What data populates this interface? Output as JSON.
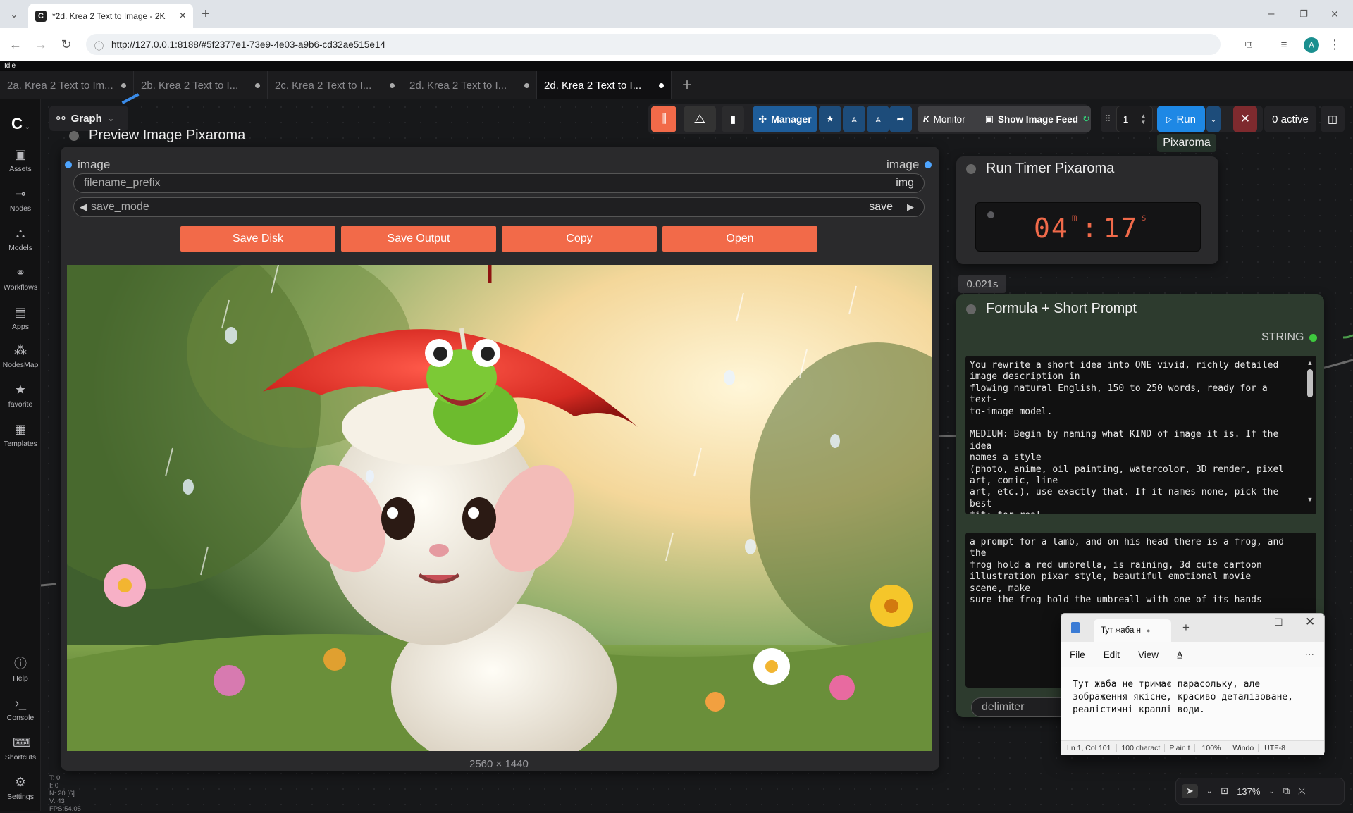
{
  "browser": {
    "tab_title": "*2d. Krea 2 Text to Image - 2K",
    "url": "http://127.0.0.1:8188/#5f2377e1-73e9-4e03-a9b6-cd32ae515e14",
    "avatar_letter": "A"
  },
  "status": {
    "idle": "Idle"
  },
  "workflow_tabs": [
    {
      "label": "2a. Krea 2 Text to Im..."
    },
    {
      "label": "2b. Krea 2 Text to I..."
    },
    {
      "label": "2c. Krea 2 Text to I..."
    },
    {
      "label": "2d. Krea 2 Text to I..."
    },
    {
      "label": "2d. Krea 2 Text to I..."
    }
  ],
  "sidebar": {
    "items": [
      {
        "label": "Assets",
        "icon": "image-icon"
      },
      {
        "label": "Nodes",
        "icon": "nodes-icon"
      },
      {
        "label": "Models",
        "icon": "models-icon"
      },
      {
        "label": "Workflows",
        "icon": "workflows-icon"
      },
      {
        "label": "Apps",
        "icon": "apps-icon"
      },
      {
        "label": "NodesMap",
        "icon": "nodesmap-icon"
      },
      {
        "label": "favorite",
        "icon": "star-icon"
      },
      {
        "label": "Templates",
        "icon": "templates-icon"
      }
    ],
    "bottom": [
      {
        "label": "Help",
        "icon": "help-icon"
      },
      {
        "label": "Console",
        "icon": "console-icon"
      },
      {
        "label": "Shortcuts",
        "icon": "keyboard-icon"
      },
      {
        "label": "Settings",
        "icon": "gear-icon"
      }
    ],
    "stats": [
      "T: 0",
      "I: 0",
      "N: 20 [6]",
      "V: 43",
      "FPS:54.05"
    ]
  },
  "toolbar": {
    "graph_label": "Graph",
    "manager_label": "Manager",
    "monitor_label": "Monitor",
    "monitor_prefix": "K",
    "show_image_feed": "Show Image Feed",
    "queue_count": "1",
    "run_label": "Run",
    "active_label": "0 active",
    "pixaroma_tag": "Pixaroma"
  },
  "preview_node": {
    "title": "Preview Image Pixaroma",
    "input_label": "image",
    "output_label": "image",
    "filename_prefix_label": "filename_prefix",
    "filename_prefix_value": "img",
    "save_mode_label": "save_mode",
    "save_mode_value": "save",
    "buttons": [
      "Save Disk",
      "Save Output",
      "Copy",
      "Open"
    ],
    "image_size": "2560 × 1440"
  },
  "timer_node": {
    "title": "Run Timer Pixaroma",
    "minutes": "04",
    "seconds": "17",
    "m_unit": "m",
    "s_unit": "s",
    "elapsed": "0.021s"
  },
  "formula_node": {
    "title": "Formula + Short Prompt",
    "output_type": "STRING",
    "system_prompt": "You rewrite a short idea into ONE vivid, richly detailed\nimage description in\nflowing natural English, 150 to 250 words, ready for a text-\nto-image model.\n\nMEDIUM: Begin by naming what KIND of image it is. If the idea\nnames a style\n(photo, anime, oil painting, watercolor, 3D render, pixel\nart, comic, line\nart, etc.), use exactly that. If it names none, pick the best\nfit: for real\npeople, places, objects, or any true-to-life scene, make it a\nrealistic",
    "user_prompt": "a prompt for a lamb, and on his head there is a frog, and the\nfrog hold a red umbrella, is raining, 3d cute cartoon\nillustration pixar style, beautiful emotional movie scene, make\nsure the frog hold the umbreall with one of its hands",
    "delimiter_label": "delimiter"
  },
  "notepad": {
    "tab_title": "Тут жаба н",
    "menu": [
      "File",
      "Edit",
      "View"
    ],
    "text": "Тут жаба не тримає парасольку, але\nзображення якісне, красиво деталізоване,\nреалістичні краплі води.",
    "status": [
      "Ln 1, Col 101",
      "100 charact",
      "Plain t",
      "100%",
      "Windo",
      "UTF-8"
    ]
  },
  "canvas_controls": {
    "zoom": "137%"
  },
  "colors": {
    "accent_orange": "#f26a49",
    "run_blue": "#1e88e5",
    "node_green": "#2d3b2e"
  }
}
